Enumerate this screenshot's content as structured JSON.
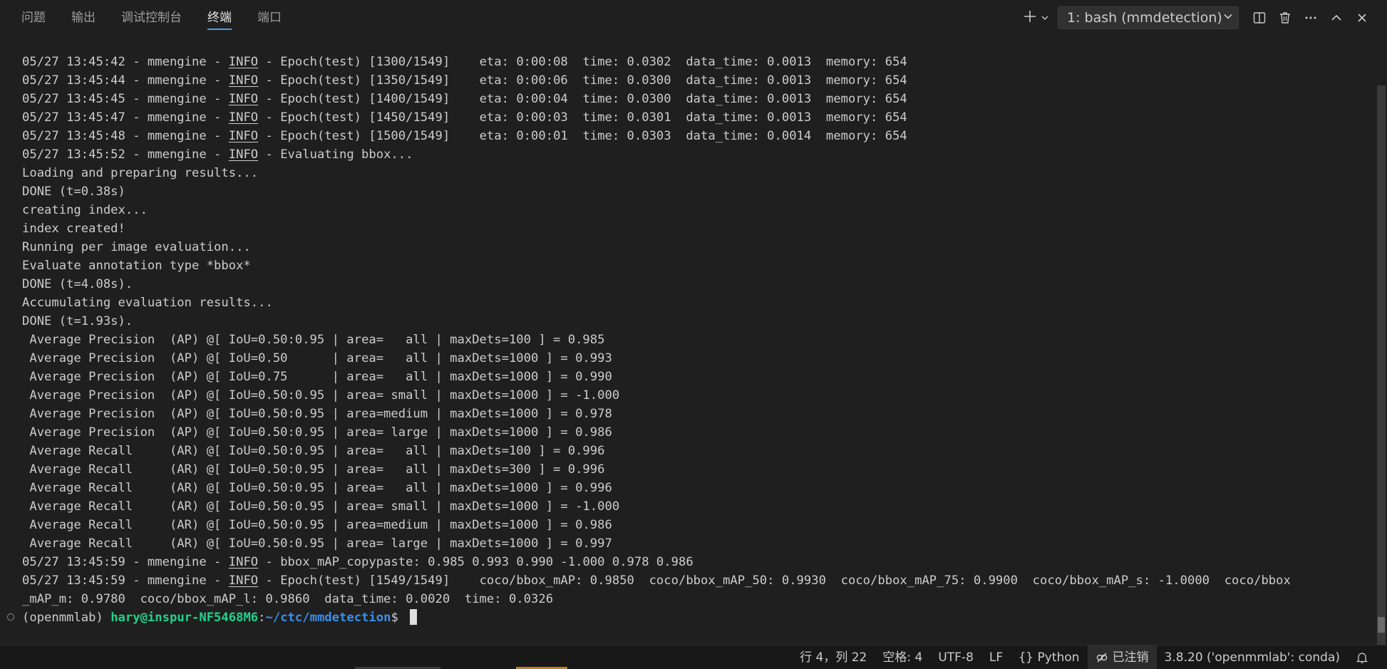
{
  "panel": {
    "tabs": [
      {
        "label": "问题",
        "active": false
      },
      {
        "label": "输出",
        "active": false
      },
      {
        "label": "调试控制台",
        "active": false
      },
      {
        "label": "终端",
        "active": true
      },
      {
        "label": "端口",
        "active": false
      }
    ],
    "terminal_selector": "1: bash (mmdetection)",
    "icons": [
      "plus-icon",
      "chevron-down-icon",
      "split-icon",
      "trash-icon",
      "more-icon",
      "chevron-up-icon",
      "close-icon"
    ]
  },
  "terminal": {
    "lines": [
      {
        "pre": "05/27 13:45:42 - mmengine - ",
        "lvl": "INFO",
        "post": " - Epoch(test) [1300/1549]    eta: 0:00:08  time: 0.0302  data_time: 0.0013  memory: 654"
      },
      {
        "pre": "05/27 13:45:44 - mmengine - ",
        "lvl": "INFO",
        "post": " - Epoch(test) [1350/1549]    eta: 0:00:06  time: 0.0300  data_time: 0.0013  memory: 654"
      },
      {
        "pre": "05/27 13:45:45 - mmengine - ",
        "lvl": "INFO",
        "post": " - Epoch(test) [1400/1549]    eta: 0:00:04  time: 0.0300  data_time: 0.0013  memory: 654"
      },
      {
        "pre": "05/27 13:45:47 - mmengine - ",
        "lvl": "INFO",
        "post": " - Epoch(test) [1450/1549]    eta: 0:00:03  time: 0.0301  data_time: 0.0013  memory: 654"
      },
      {
        "pre": "05/27 13:45:48 - mmengine - ",
        "lvl": "INFO",
        "post": " - Epoch(test) [1500/1549]    eta: 0:00:01  time: 0.0303  data_time: 0.0014  memory: 654"
      },
      {
        "pre": "05/27 13:45:52 - mmengine - ",
        "lvl": "INFO",
        "post": " - Evaluating bbox..."
      },
      {
        "pre": "Loading and preparing results...",
        "lvl": "",
        "post": ""
      },
      {
        "pre": "DONE (t=0.38s)",
        "lvl": "",
        "post": ""
      },
      {
        "pre": "creating index...",
        "lvl": "",
        "post": ""
      },
      {
        "pre": "index created!",
        "lvl": "",
        "post": ""
      },
      {
        "pre": "Running per image evaluation...",
        "lvl": "",
        "post": ""
      },
      {
        "pre": "Evaluate annotation type *bbox*",
        "lvl": "",
        "post": ""
      },
      {
        "pre": "DONE (t=4.08s).",
        "lvl": "",
        "post": ""
      },
      {
        "pre": "Accumulating evaluation results...",
        "lvl": "",
        "post": ""
      },
      {
        "pre": "DONE (t=1.93s).",
        "lvl": "",
        "post": ""
      },
      {
        "pre": " Average Precision  (AP) @[ IoU=0.50:0.95 | area=   all | maxDets=100 ] = 0.985",
        "lvl": "",
        "post": ""
      },
      {
        "pre": " Average Precision  (AP) @[ IoU=0.50      | area=   all | maxDets=1000 ] = 0.993",
        "lvl": "",
        "post": ""
      },
      {
        "pre": " Average Precision  (AP) @[ IoU=0.75      | area=   all | maxDets=1000 ] = 0.990",
        "lvl": "",
        "post": ""
      },
      {
        "pre": " Average Precision  (AP) @[ IoU=0.50:0.95 | area= small | maxDets=1000 ] = -1.000",
        "lvl": "",
        "post": ""
      },
      {
        "pre": " Average Precision  (AP) @[ IoU=0.50:0.95 | area=medium | maxDets=1000 ] = 0.978",
        "lvl": "",
        "post": ""
      },
      {
        "pre": " Average Precision  (AP) @[ IoU=0.50:0.95 | area= large | maxDets=1000 ] = 0.986",
        "lvl": "",
        "post": ""
      },
      {
        "pre": " Average Recall     (AR) @[ IoU=0.50:0.95 | area=   all | maxDets=100 ] = 0.996",
        "lvl": "",
        "post": ""
      },
      {
        "pre": " Average Recall     (AR) @[ IoU=0.50:0.95 | area=   all | maxDets=300 ] = 0.996",
        "lvl": "",
        "post": ""
      },
      {
        "pre": " Average Recall     (AR) @[ IoU=0.50:0.95 | area=   all | maxDets=1000 ] = 0.996",
        "lvl": "",
        "post": ""
      },
      {
        "pre": " Average Recall     (AR) @[ IoU=0.50:0.95 | area= small | maxDets=1000 ] = -1.000",
        "lvl": "",
        "post": ""
      },
      {
        "pre": " Average Recall     (AR) @[ IoU=0.50:0.95 | area=medium | maxDets=1000 ] = 0.986",
        "lvl": "",
        "post": ""
      },
      {
        "pre": " Average Recall     (AR) @[ IoU=0.50:0.95 | area= large | maxDets=1000 ] = 0.997",
        "lvl": "",
        "post": ""
      },
      {
        "pre": "05/27 13:45:59 - mmengine - ",
        "lvl": "INFO",
        "post": " - bbox_mAP_copypaste: 0.985 0.993 0.990 -1.000 0.978 0.986"
      },
      {
        "pre": "05/27 13:45:59 - mmengine - ",
        "lvl": "INFO",
        "post": " - Epoch(test) [1549/1549]    coco/bbox_mAP: 0.9850  coco/bbox_mAP_50: 0.9930  coco/bbox_mAP_75: 0.9900  coco/bbox_mAP_s: -1.0000  coco/bbox"
      },
      {
        "pre": "_mAP_m: 0.9780  coco/bbox_mAP_l: 0.9860  data_time: 0.0020  time: 0.0326",
        "lvl": "",
        "post": ""
      }
    ],
    "prompt": {
      "env": "(openmmlab) ",
      "user_host": "hary@inspur-NF5468M6",
      "sep": ":",
      "path": "~/ctc/mmdetection",
      "symbol": "$ "
    }
  },
  "statusbar": {
    "position": "行 4，列 22",
    "spaces": "空格: 4",
    "encoding": "UTF-8",
    "eol": "LF",
    "language": "Python",
    "account": "已注销",
    "interpreter": "3.8.20 ('openmmlab': conda)"
  }
}
